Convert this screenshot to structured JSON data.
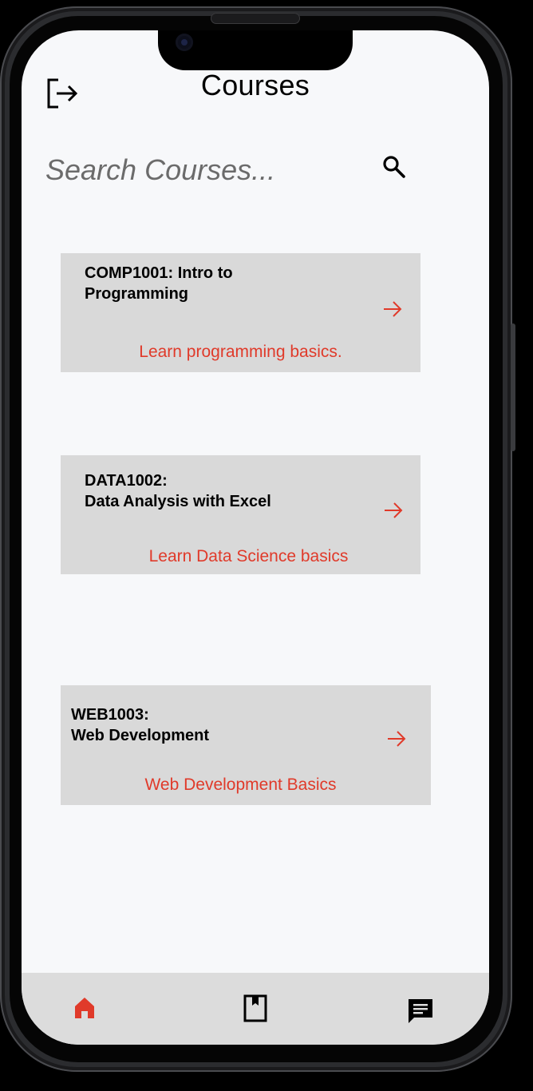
{
  "header": {
    "title": "Courses",
    "logout_icon": "logout-icon"
  },
  "search": {
    "placeholder": "Search Courses...",
    "value": "",
    "icon": "search-icon"
  },
  "courses": [
    {
      "title": "COMP1001: Intro to\nProgramming",
      "description": "Learn programming basics.",
      "icon": "arrow-right-icon"
    },
    {
      "title": "DATA1002:\nData Analysis with Excel",
      "description": "Learn Data Science basics",
      "icon": "arrow-right-icon"
    },
    {
      "title": "WEB1003:\nWeb Development",
      "description": "Web Development Basics",
      "icon": "arrow-right-icon"
    }
  ],
  "bottom_nav": {
    "items": [
      {
        "icon": "home-icon",
        "active": true
      },
      {
        "icon": "bookmark-icon",
        "active": false
      },
      {
        "icon": "chat-icon",
        "active": false
      }
    ]
  },
  "colors": {
    "accent": "#e03a2a",
    "card_bg": "#d9d9d9",
    "screen_bg": "#f7f8fa",
    "nav_bg": "#dcdcdc"
  }
}
